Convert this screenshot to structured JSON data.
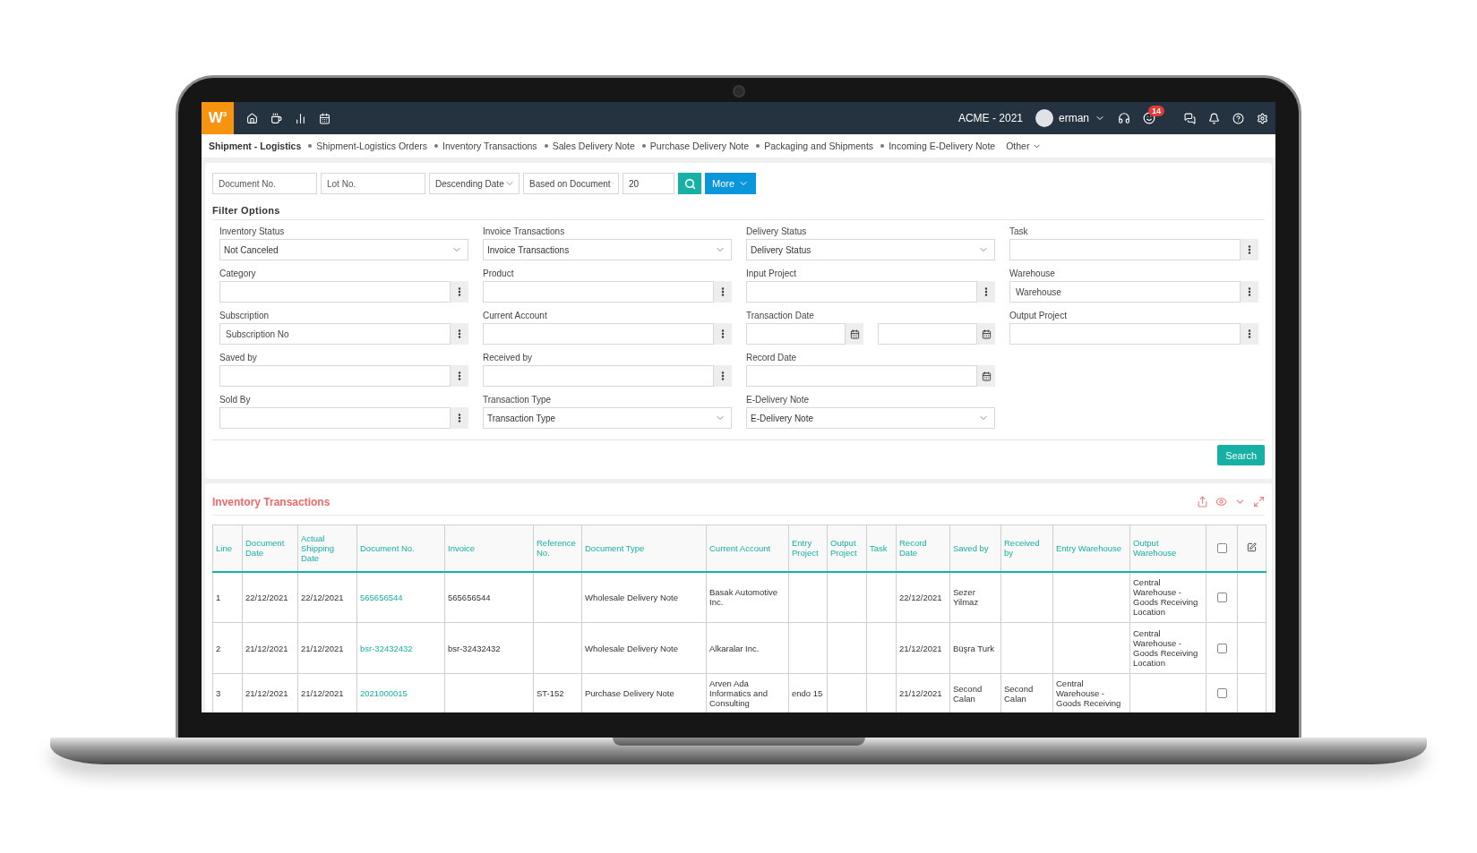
{
  "topbar": {
    "logo": "W$^{3}$",
    "company": "ACME - 2021",
    "user": "erman",
    "badge": "14"
  },
  "nav": {
    "title": "Shipment - Logistics",
    "items": [
      "Shipment-Logistics Orders",
      "Inventory Transactions",
      "Sales Delivery Note",
      "Purchase Delivery Note",
      "Packaging and Shipments",
      "Incoming E-Delivery Note"
    ],
    "more": "Other"
  },
  "quick_filters": [
    {
      "kind": "text",
      "placeholder": "Document No."
    },
    {
      "kind": "text",
      "placeholder": "Lot No."
    },
    {
      "kind": "select",
      "value": "Descending Date"
    },
    {
      "kind": "select",
      "value": "Based on Document"
    },
    {
      "kind": "text",
      "value": "20"
    }
  ],
  "more_button": "More",
  "filter_title": "Filter Options",
  "filter_rows": [
    [
      {
        "label": "Inventory Status",
        "kind": "select",
        "value": "Not Canceled"
      },
      {
        "label": "Invoice Transactions",
        "kind": "select",
        "value": "Invoice Transactions"
      },
      {
        "label": "Delivery Status",
        "kind": "select",
        "value": "Delivery Status"
      },
      {
        "label": "Task",
        "kind": "lookup"
      }
    ],
    [
      {
        "label": "Category",
        "kind": "lookup"
      },
      {
        "label": "Product",
        "kind": "lookup"
      },
      {
        "label": "Input Project",
        "kind": "lookup"
      },
      {
        "label": "Warehouse",
        "kind": "lookup",
        "placeholder": "Warehouse"
      }
    ],
    [
      {
        "label": "Subscription",
        "kind": "lookup",
        "placeholder": "Subscription No"
      },
      {
        "label": "Current Account",
        "kind": "lookup"
      },
      {
        "label": "Transaction Date",
        "kind": "daterange"
      },
      {
        "label": "Output Project",
        "kind": "lookup"
      }
    ],
    [
      {
        "label": "Saved by",
        "kind": "lookup"
      },
      {
        "label": "Received by",
        "kind": "lookup"
      },
      {
        "label": "Record Date",
        "kind": "date"
      }
    ],
    [
      {
        "label": "Sold By",
        "kind": "lookup"
      },
      {
        "label": "Transaction Type",
        "kind": "select",
        "value": "Transaction Type"
      },
      {
        "label": "E-Delivery Note",
        "kind": "select",
        "value": "E-Delivery Note"
      }
    ]
  ],
  "search_button": "Search",
  "table": {
    "title": "Inventory Transactions",
    "header_checkbox": {
      "checked": false
    },
    "columns": [
      {
        "label": "Line",
        "kind": "text"
      },
      {
        "label": "Document Date",
        "kind": "text"
      },
      {
        "label": "Actual Shipping Date",
        "kind": "text"
      },
      {
        "label": "Document No.",
        "kind": "link"
      },
      {
        "label": "Invoice",
        "kind": "text"
      },
      {
        "label": "Reference No.",
        "kind": "text"
      },
      {
        "label": "Document Type",
        "kind": "text"
      },
      {
        "label": "Current Account",
        "kind": "text"
      },
      {
        "label": "Entry Project",
        "kind": "text"
      },
      {
        "label": "Output Project",
        "kind": "text"
      },
      {
        "label": "Task",
        "kind": "text"
      },
      {
        "label": "Record Date",
        "kind": "text"
      },
      {
        "label": "Saved by",
        "kind": "text"
      },
      {
        "label": "Received by",
        "kind": "text"
      },
      {
        "label": "Entry Warehouse",
        "kind": "text"
      },
      {
        "label": "Output Warehouse",
        "kind": "text"
      }
    ],
    "rows": [
      {
        "checked": false,
        "cells": [
          "1",
          "22/12/2021",
          "22/12/2021",
          "565656544",
          "565656544",
          "",
          "Wholesale Delivery Note",
          "Basak Automotive Inc.",
          "",
          "",
          "",
          "22/12/2021",
          "Sezer Yilmaz",
          "",
          "",
          "Central Warehouse - Goods Receiving Location"
        ]
      },
      {
        "checked": false,
        "cells": [
          "2",
          "21/12/2021",
          "21/12/2021",
          "bsr-32432432",
          "bsr-32432432",
          "",
          "Wholesale Delivery Note",
          "Alkaralar Inc.",
          "",
          "",
          "",
          "21/12/2021",
          "Büşra Turk",
          "",
          "",
          "Central Warehouse - Goods Receiving Location"
        ]
      },
      {
        "checked": false,
        "cells": [
          "3",
          "21/12/2021",
          "21/12/2021",
          "2021000015",
          "",
          "ST-152",
          "Purchase Delivery Note",
          "Arven Ada Informatics and Consulting",
          "endo 15",
          "",
          "",
          "21/12/2021",
          "Second Calan",
          "Second Calan",
          "Central Warehouse - Goods Receiving",
          ""
        ]
      }
    ]
  }
}
